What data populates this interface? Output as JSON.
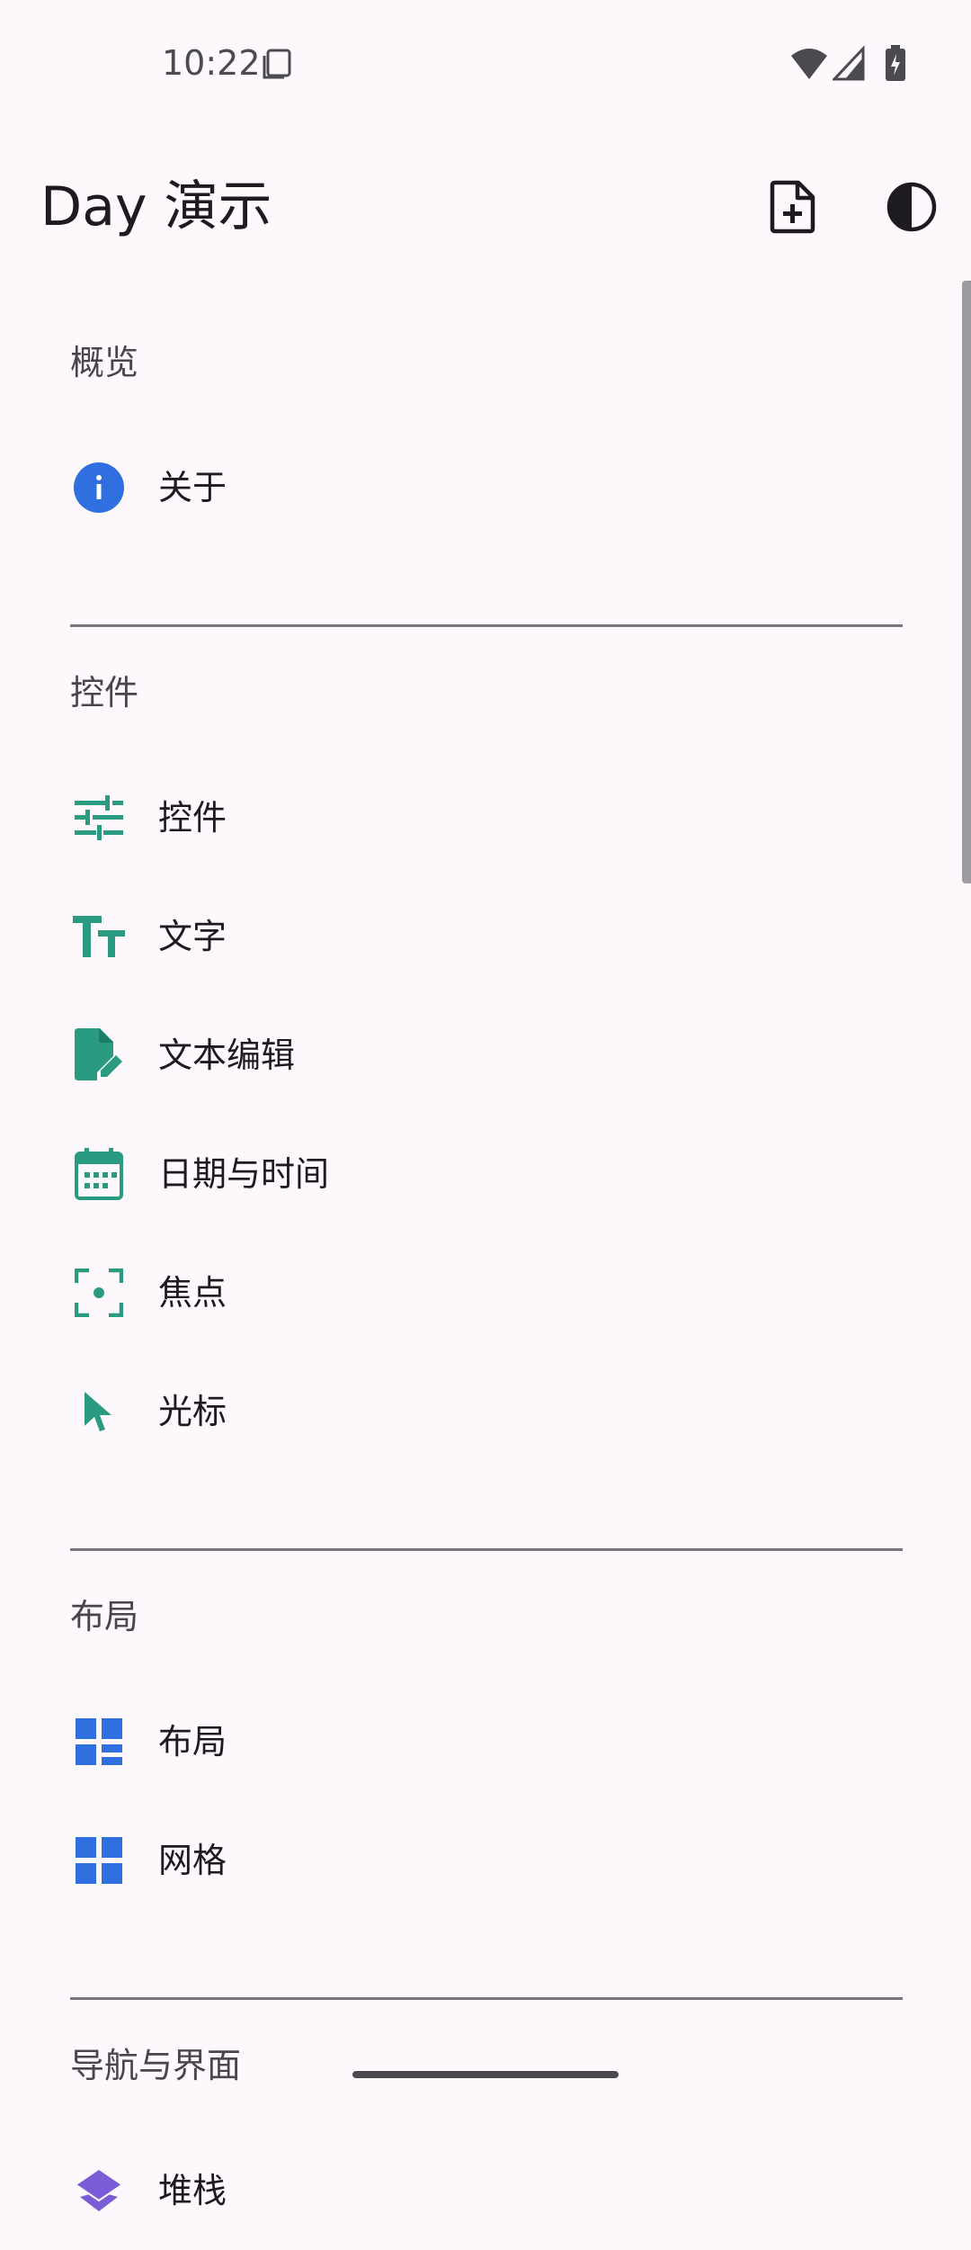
{
  "status_bar": {
    "time": "10:22"
  },
  "app_bar": {
    "title": "Day 演示",
    "actions": [
      {
        "name": "new-document",
        "icon": "note-add-icon"
      },
      {
        "name": "theme-toggle",
        "icon": "contrast-icon"
      }
    ]
  },
  "colors": {
    "background": "#fdf8fc",
    "teal_accent": "#2a9a80",
    "blue_accent": "#2f6fe0",
    "purple_accent": "#7a5cd6",
    "divider": "#79747e"
  },
  "sections": [
    {
      "title": "概览",
      "items": [
        {
          "label": "关于",
          "icon": "info-icon"
        }
      ]
    },
    {
      "title": "控件",
      "items": [
        {
          "label": "控件",
          "icon": "tune-icon"
        },
        {
          "label": "文字",
          "icon": "text-fields-icon"
        },
        {
          "label": "文本编辑",
          "icon": "edit-document-icon"
        },
        {
          "label": "日期与时间",
          "icon": "calendar-icon"
        },
        {
          "label": "焦点",
          "icon": "center-focus-icon"
        },
        {
          "label": "光标",
          "icon": "cursor-arrow-icon"
        }
      ]
    },
    {
      "title": "布局",
      "items": [
        {
          "label": "布局",
          "icon": "dashboard-layout-icon"
        },
        {
          "label": "网格",
          "icon": "grid-view-icon"
        }
      ]
    },
    {
      "title": "导航与界面",
      "items": [
        {
          "label": "堆栈",
          "icon": "layers-icon"
        }
      ]
    }
  ]
}
